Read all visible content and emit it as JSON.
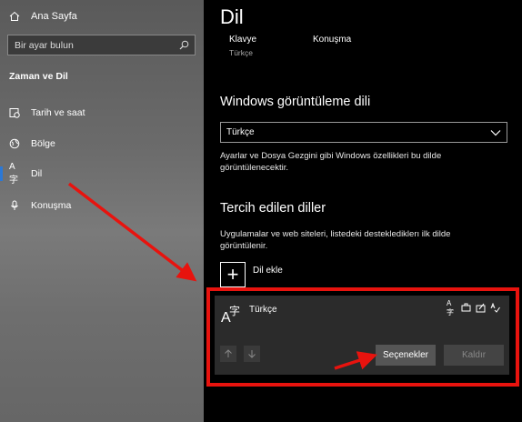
{
  "sidebar": {
    "home_label": "Ana Sayfa",
    "search_placeholder": "Bir ayar bulun",
    "section_title": "Zaman ve Dil",
    "items": [
      {
        "label": "Tarih ve saat",
        "icon": "clock-calendar-icon"
      },
      {
        "label": "Bölge",
        "icon": "globe-icon"
      },
      {
        "label": "Dil",
        "icon": "language-icon",
        "active": true
      },
      {
        "label": "Konuşma",
        "icon": "microphone-icon"
      }
    ]
  },
  "main": {
    "title": "Dil",
    "quick_links": [
      {
        "label": "Klavye",
        "sub": "Türkçe"
      },
      {
        "label": "Konuşma",
        "sub": ""
      }
    ],
    "display_language": {
      "heading": "Windows görüntüleme dili",
      "selected": "Türkçe",
      "description": "Ayarlar ve Dosya Gezgini gibi Windows özellikleri bu dilde görüntülenecektir."
    },
    "preferred": {
      "heading": "Tercih edilen diller",
      "description": "Uygulamalar ve web siteleri, listedeki desteklediklerı ilk dilde görüntülenir.",
      "add_label": "Dil ekle",
      "languages": [
        {
          "name": "Türkçe",
          "options_label": "Seçenekler",
          "remove_label": "Kaldır"
        }
      ]
    }
  },
  "colors": {
    "accent": "#2b78d6",
    "annotation": "#e8130e",
    "card": "#2b2b2b"
  }
}
